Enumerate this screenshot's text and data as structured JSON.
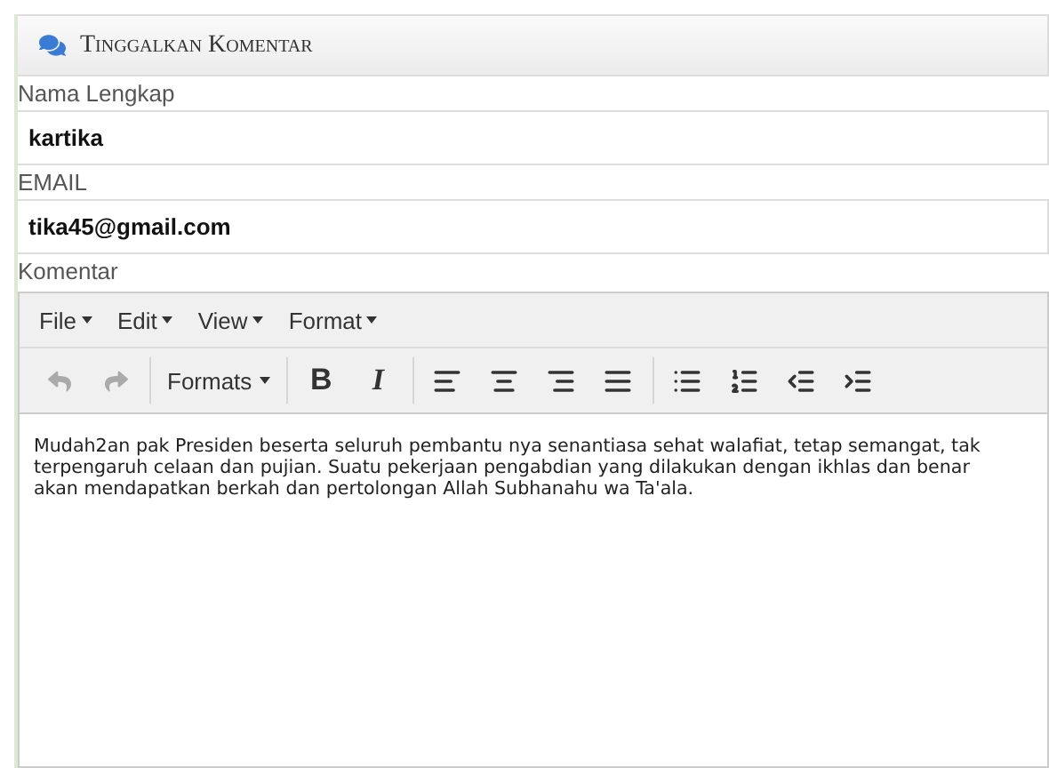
{
  "panel": {
    "title": "Tinggalkan Komentar"
  },
  "fields": [
    {
      "label": "Nama Lengkap",
      "value": "kartika"
    },
    {
      "label": "EMAIL",
      "value": "tika45@gmail.com"
    }
  ],
  "comment_label": "Komentar",
  "editor": {
    "menus": [
      "File",
      "Edit",
      "View",
      "Format"
    ],
    "toolbar": [
      {
        "kind": "undo",
        "disabled": true
      },
      {
        "kind": "redo",
        "disabled": true
      },
      {
        "kind": "separator"
      },
      {
        "kind": "dropdown",
        "label": "Formats"
      },
      {
        "kind": "separator"
      },
      {
        "kind": "bold",
        "label": "B"
      },
      {
        "kind": "italic",
        "label": "I"
      },
      {
        "kind": "separator"
      },
      {
        "kind": "align-left"
      },
      {
        "kind": "align-center"
      },
      {
        "kind": "align-right"
      },
      {
        "kind": "align-justify"
      },
      {
        "kind": "separator"
      },
      {
        "kind": "bullet-list"
      },
      {
        "kind": "numbered-list"
      },
      {
        "kind": "outdent"
      },
      {
        "kind": "indent"
      }
    ],
    "content": "Mudah2an pak Presiden beserta seluruh pembantu nya senantiasa sehat walafiat, tetap semangat, tak terpengaruh celaan dan pujian. Suatu pekerjaan pengabdian yang dilakukan dengan ikhlas dan benar akan mendapatkan berkah dan pertolongan Allah Subhanahu wa Ta'ala."
  }
}
